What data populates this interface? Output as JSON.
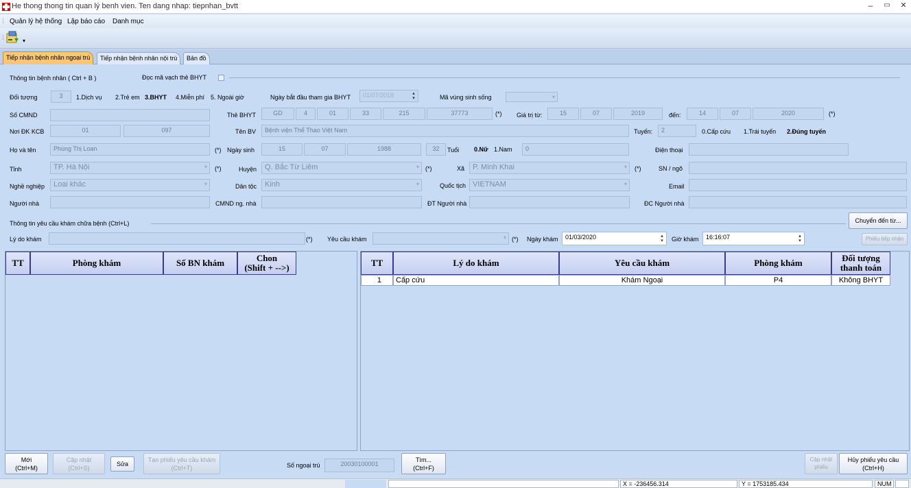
{
  "window": {
    "title": "He thong thong tin quan lý benh vien. Ten dang nhap: tiepnhan_bvtt",
    "minimize": "–",
    "restore": "▭",
    "close": "✕"
  },
  "menu": [
    "Quản lý hệ thống",
    "Lập báo cáo",
    "Danh mục"
  ],
  "tabs": [
    "Tiếp nhận bệnh nhân ngoại trú",
    "Tiếp nhận bệnh nhân nội trú",
    "Bản đồ"
  ],
  "patient": {
    "section_title": "Thông tin bệnh nhân ( Ctrl + B )",
    "barcode_label": "Đọc mã vạch thẻ BHYT",
    "doi_tuong_label": "Đối tượng",
    "doi_tuong_value": "3",
    "doi_tuong_opts": [
      "1.Dịch vụ",
      "2.Trẻ em",
      "3.BHYT",
      "4.Miễn phí",
      "5. Ngoài giờ"
    ],
    "ngay_bhyt_label": "Ngày bắt đầu tham gia BHYT",
    "ngay_bhyt_value": "01/07/2018",
    "ma_vung_label": "Mã vùng sinh sống",
    "cmnd_label": "Số CMND",
    "the_bhyt_label": "Thẻ BHYT",
    "the_bhyt": [
      "GD",
      "4",
      "01",
      "33",
      "215",
      "37773"
    ],
    "req": "(*)",
    "gia_tri_label": "Giá trị từ:",
    "gia_tri_tu": [
      "15",
      "07",
      "2019"
    ],
    "den_label": "đến:",
    "gia_tri_den": [
      "14",
      "07",
      "2020"
    ],
    "noi_dk_label": "Nơi ĐK KCB",
    "noi_dk": [
      "01",
      "097"
    ],
    "ten_bv_label": "Tên BV",
    "ten_bv": "Bệnh viện Thể Thao Việt Nam",
    "tuyen_label": "Tuyến:",
    "tuyen_value": "2",
    "tuyen_opts": [
      "0.Cấp cứu",
      "1.Trái tuyến",
      "2.Đúng tuyến"
    ],
    "ho_ten_label": "Họ và tên",
    "ho_ten": "Phùng Thị Loan",
    "ngay_sinh_label": "Ngày sinh",
    "ngay_sinh": [
      "15",
      "07",
      "1988"
    ],
    "tuoi_value": "32",
    "tuoi_label": "Tuổi",
    "gioi_opts": [
      "0.Nữ",
      "1.Nam"
    ],
    "gioi_value": "0",
    "dien_thoai_label": "Điện thoại",
    "tinh_label": "Tỉnh",
    "tinh": "TP. Hà Nội",
    "huyen_label": "Huyện",
    "huyen": "Q. Bắc Từ Liêm",
    "xa_label": "Xã",
    "xa": "P. Minh Khai",
    "sn_label": "SN / ngõ",
    "nghe_label": "Nghề nghiệp",
    "nghe": "Loại khác",
    "dan_toc_label": "Dân tộc",
    "dan_toc": "Kinh",
    "quoc_tich_label": "Quốc tịch",
    "quoc_tich": "VIETNAM",
    "email_label": "Email",
    "nguoi_nha_label": "Người nhà",
    "cmnd_nn_label": "CMND ng. nhà",
    "dt_nn_label": "ĐT Người nhà",
    "dc_nn_label": "ĐC Người nhà"
  },
  "request": {
    "section_title": "Thông tin yêu cầu khám chữa bệnh (Ctrl+L)",
    "chuyen_btn": "Chuyển đến từ...",
    "ly_do_label": "Lý do khám",
    "yeu_cau_label": "Yêu cầu khám",
    "ngay_kham_label": "Ngày khám",
    "ngay_kham": "01/03/2020",
    "gio_kham_label": "Giờ khám",
    "gio_kham": "16:16:07",
    "phieu_btn": "Phiếu tiếp nhận"
  },
  "left_grid": {
    "headers": [
      "TT",
      "Phòng khám",
      "Số BN khám",
      "Chon\n(Shift + -->)"
    ]
  },
  "right_grid": {
    "headers": [
      "TT",
      "Lý do khám",
      "Yêu cầu khám",
      "Phòng khám",
      "Đối tượng\nthanh toán"
    ],
    "rows": [
      [
        "1",
        "Cấp cứu",
        "Khám Ngoại",
        "P4",
        "Không BHYT"
      ]
    ]
  },
  "bottom": {
    "moi": "Mới\n(Ctrl+M)",
    "cap_nhat": "Cập nhật\n(Ctrl+S)",
    "sua": "Sửa",
    "tao_phieu": "Tạo phiếu yêu cầu khám\n(Ctrl+T)",
    "so_ngoai_tru_label": "Số ngoại trú",
    "so_ngoai_tru": "20030100001",
    "tim": "Tìm...\n(Ctrl+F)",
    "cap_nhat_phieu": "Cập nhật\nphiếu",
    "huy_phieu": "Hủy phiếu yêu cầu\n(Ctrl+H)"
  },
  "status": {
    "x": "X = -236456.314",
    "y": "Y = 1753185.434",
    "num": "NUM"
  }
}
